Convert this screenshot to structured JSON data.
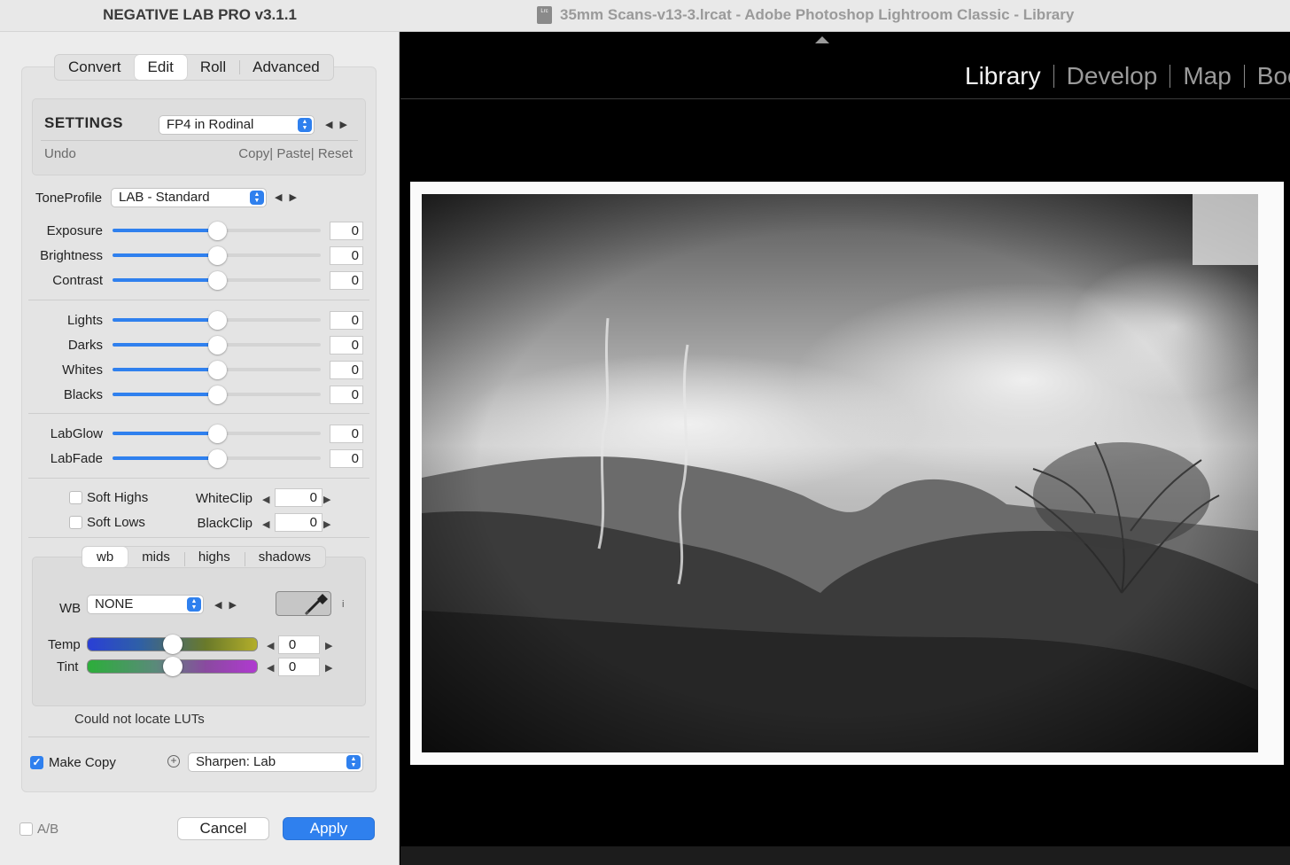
{
  "lightroom": {
    "window_title": "35mm Scans-v13-3.lrcat - Adobe Photoshop Lightroom Classic - Library",
    "doc_icon_text": "Lrc",
    "modules": [
      "Library",
      "Develop",
      "Map",
      "Boo"
    ],
    "active_module": "Library"
  },
  "nlp": {
    "title": "NEGATIVE LAB PRO v3.1.1",
    "tabs": [
      "Convert",
      "Edit",
      "Roll",
      "Advanced"
    ],
    "active_tab": "Edit",
    "settings": {
      "label": "SETTINGS",
      "preset": "FP4 in Rodinal",
      "undo": "Undo",
      "copy": "Copy",
      "paste": "Paste",
      "reset": "Reset"
    },
    "tone_profile": {
      "label": "ToneProfile",
      "value": "LAB - Standard"
    },
    "sliders_group1": [
      {
        "label": "Exposure",
        "value": "0",
        "position": 0.5
      },
      {
        "label": "Brightness",
        "value": "0",
        "position": 0.5
      },
      {
        "label": "Contrast",
        "value": "0",
        "position": 0.5
      }
    ],
    "sliders_group2": [
      {
        "label": "Lights",
        "value": "0",
        "position": 0.5
      },
      {
        "label": "Darks",
        "value": "0",
        "position": 0.5
      },
      {
        "label": "Whites",
        "value": "0",
        "position": 0.5
      },
      {
        "label": "Blacks",
        "value": "0",
        "position": 0.5
      }
    ],
    "sliders_group3": [
      {
        "label": "LabGlow",
        "value": "0",
        "position": 0.5
      },
      {
        "label": "LabFade",
        "value": "0",
        "position": 0.5
      }
    ],
    "soft_highs": {
      "label": "Soft Highs",
      "checked": false
    },
    "soft_lows": {
      "label": "Soft Lows",
      "checked": false
    },
    "white_clip": {
      "label": "WhiteClip",
      "value": "0"
    },
    "black_clip": {
      "label": "BlackClip",
      "value": "0"
    },
    "color_tabs": [
      "wb",
      "mids",
      "highs",
      "shadows"
    ],
    "active_color_tab": "wb",
    "wb": {
      "label": "WB",
      "value": "NONE",
      "info": "i"
    },
    "temp": {
      "label": "Temp",
      "value": "0",
      "position": 0.5
    },
    "tint": {
      "label": "Tint",
      "value": "0",
      "position": 0.5
    },
    "luts_message": "Could not locate LUTs",
    "make_copy": {
      "label": "Make Copy",
      "checked": true
    },
    "sharpen": {
      "value": "Sharpen: Lab"
    },
    "ab": {
      "label": "A/B",
      "checked": false
    },
    "cancel_label": "Cancel",
    "apply_label": "Apply"
  },
  "colors": {
    "accent": "#2f80ee",
    "dialog_bg": "#ececec",
    "lightroom_bg": "#000000"
  }
}
